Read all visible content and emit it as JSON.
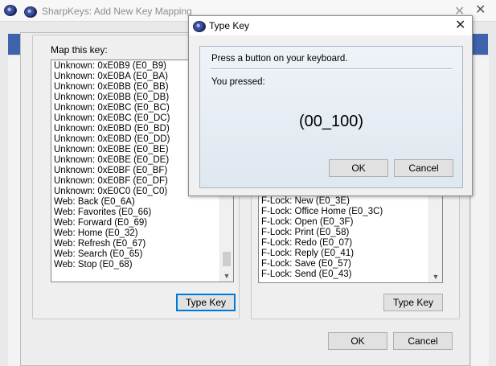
{
  "main_window": {
    "title": ""
  },
  "mapping_dialog": {
    "title": "SharpKeys: Add New Key Mapping",
    "map_from_label": "Map this key:",
    "from_list": [
      "Unknown: 0xE0B9 (E0_B9)",
      "Unknown: 0xE0BA (E0_BA)",
      "Unknown: 0xE0BB (E0_BB)",
      "Unknown: 0xE0BB (E0_DB)",
      "Unknown: 0xE0BC (E0_BC)",
      "Unknown: 0xE0BC (E0_DC)",
      "Unknown: 0xE0BD (E0_BD)",
      "Unknown: 0xE0BD (E0_DD)",
      "Unknown: 0xE0BE (E0_BE)",
      "Unknown: 0xE0BE (E0_DE)",
      "Unknown: 0xE0BF (E0_BF)",
      "Unknown: 0xE0BF (E0_DF)",
      "Unknown: 0xE0C0 (E0_C0)",
      "Web: Back (E0_6A)",
      "Web: Favorites (E0_66)",
      "Web: Forward (E0_69)",
      "Web: Home (E0_32)",
      "Web: Refresh (E0_67)",
      "Web: Search (E0_65)",
      "Web: Stop (E0_68)"
    ],
    "to_list": [
      "F-Lock: New (E0_3E)",
      "F-Lock: Office Home (E0_3C)",
      "F-Lock: Open (E0_3F)",
      "F-Lock: Print (E0_58)",
      "F-Lock: Redo (E0_07)",
      "F-Lock: Reply (E0_41)",
      "F-Lock: Save (E0_57)",
      "F-Lock: Send (E0_43)"
    ],
    "type_key_left": "Type Key",
    "type_key_right": "Type Key",
    "ok": "OK",
    "cancel": "Cancel"
  },
  "type_key_dialog": {
    "title": "Type Key",
    "prompt": "Press a button on your keyboard.",
    "pressed_label": "You pressed:",
    "pressed_value": "(00_100)",
    "ok": "OK",
    "cancel": "Cancel"
  },
  "icons": {
    "app": "sharpkeys-app-icon",
    "close": "close-icon",
    "scroll_up": "chevron-up-icon",
    "scroll_down": "chevron-down-icon"
  },
  "colors": {
    "accent_blue": "#3f63ad",
    "focus_border": "#0078d7"
  }
}
